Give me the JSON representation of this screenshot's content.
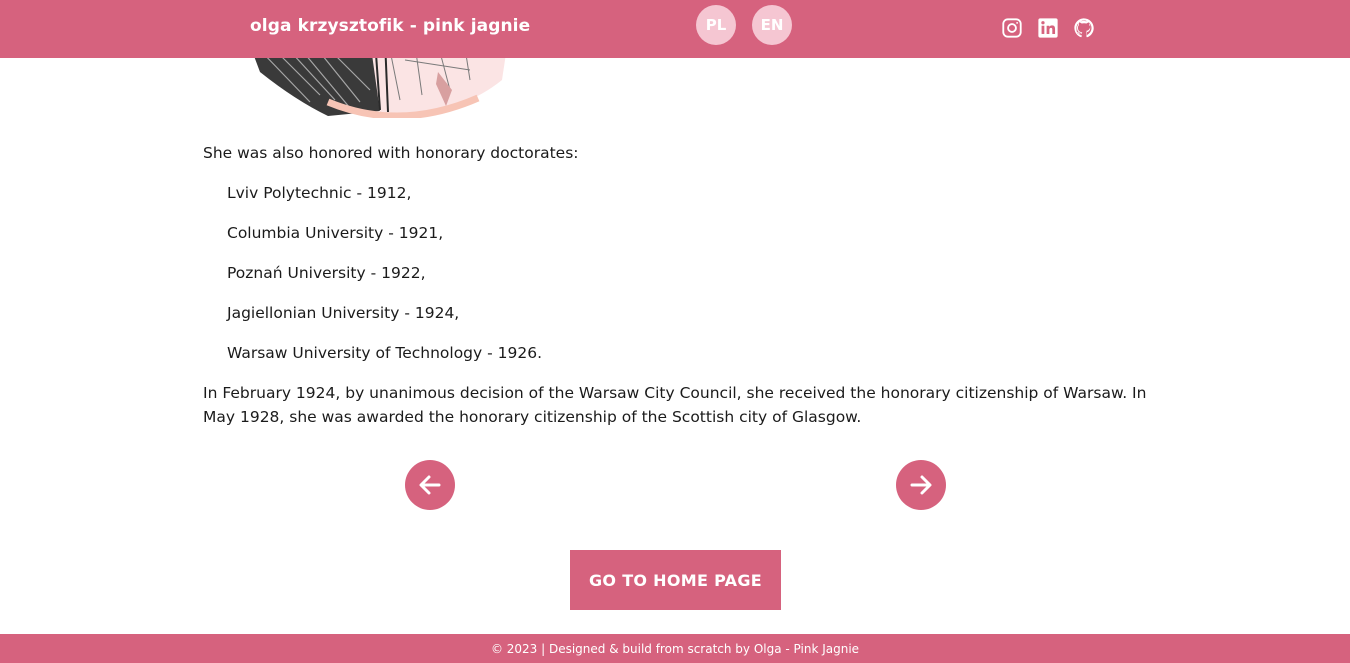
{
  "header": {
    "brand": "olga krzysztofik - pink jagnie",
    "languages": [
      {
        "label": "PL"
      },
      {
        "label": "EN"
      }
    ],
    "social": [
      {
        "icon": "instagram-icon"
      },
      {
        "icon": "linkedin-icon"
      },
      {
        "icon": "github-icon"
      }
    ]
  },
  "content": {
    "intro": "She was also honored with honorary doctorates:",
    "doctorates": [
      "Lviv Polytechnic - 1912,",
      "Columbia University - 1921,",
      "Poznań University - 1922,",
      "Jagiellonian University - 1924,",
      "Warsaw University of Technology - 1926."
    ],
    "closing": "In February 1924, by unanimous decision of the Warsaw City Council, she received the honorary citizenship of Warsaw. In May 1928, she was awarded the honorary citizenship of the Scottish city of Glasgow."
  },
  "navigation": {
    "prev_icon": "arrow-left-icon",
    "next_icon": "arrow-right-icon",
    "home_label": "GO TO HOME PAGE"
  },
  "footer": {
    "text": "© 2023 | Designed & build from scratch by Olga - Pink Jagnie"
  },
  "colors": {
    "accent": "#d6627e",
    "lang_bubble": "#f5c6d2",
    "text": "#1b1b1b",
    "background": "#ffffff"
  }
}
